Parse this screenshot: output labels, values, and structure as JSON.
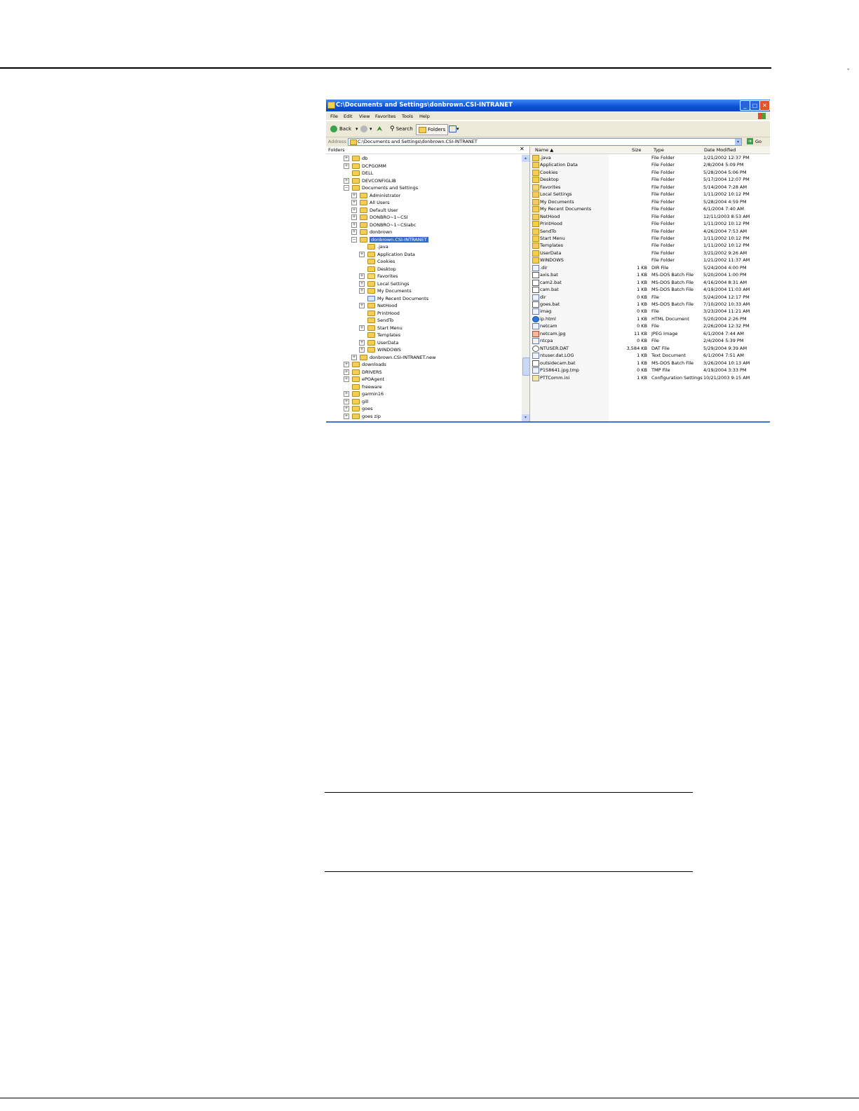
{
  "top_mark": "-",
  "window": {
    "title": "C:\\Documents and Settings\\donbrown.CSI-INTRANET",
    "buttons": {
      "minimize": "_",
      "maximize": "□",
      "close": "✕"
    }
  },
  "menu": [
    "File",
    "Edit",
    "View",
    "Favorites",
    "Tools",
    "Help"
  ],
  "toolbar": {
    "back": "Back",
    "dropdown": "▾",
    "up": "⮝",
    "search": "Search",
    "folders": "Folders",
    "views_drop": "▾"
  },
  "address": {
    "label": "Address",
    "value": "C:\\Documents and Settings\\donbrown.CSI-INTRANET",
    "drop": "▾",
    "go": "Go",
    "go_arrow": "➜"
  },
  "folders_pane": {
    "title": "Folders",
    "close": "✕",
    "items": [
      {
        "label": "db",
        "exp": "+"
      },
      {
        "label": "DCPGOMM",
        "exp": "+"
      },
      {
        "label": "DELL",
        "exp": ""
      },
      {
        "label": "DEVCONFIGLIB",
        "exp": "+"
      },
      {
        "label": "Documents and Settings",
        "exp": "−"
      },
      {
        "label": "Administrator",
        "exp": "+"
      },
      {
        "label": "All Users",
        "exp": "+"
      },
      {
        "label": "Default User",
        "exp": "+"
      },
      {
        "label": "DONBRO~1~CSI",
        "exp": "+"
      },
      {
        "label": "DONBRO~1~CSIabc",
        "exp": "+"
      },
      {
        "label": "donbrown",
        "exp": "+"
      },
      {
        "label": "donbrown.CSI-INTRANET",
        "exp": "−"
      },
      {
        "label": ".java",
        "exp": ""
      },
      {
        "label": "Application Data",
        "exp": "+"
      },
      {
        "label": "Cookies",
        "exp": ""
      },
      {
        "label": "Desktop",
        "exp": ""
      },
      {
        "label": "Favorites",
        "exp": "+"
      },
      {
        "label": "Local Settings",
        "exp": "+"
      },
      {
        "label": "My Documents",
        "exp": "+"
      },
      {
        "label": "My Recent Documents",
        "exp": ""
      },
      {
        "label": "NetHood",
        "exp": "+"
      },
      {
        "label": "PrintHood",
        "exp": ""
      },
      {
        "label": "SendTo",
        "exp": ""
      },
      {
        "label": "Start Menu",
        "exp": "+"
      },
      {
        "label": "Templates",
        "exp": ""
      },
      {
        "label": "UserData",
        "exp": "+"
      },
      {
        "label": "WINDOWS",
        "exp": "+"
      },
      {
        "label": "donbrown.CSI-INTRANET.new",
        "exp": "+"
      },
      {
        "label": "downloads",
        "exp": "+"
      },
      {
        "label": "DRIVERS",
        "exp": "+"
      },
      {
        "label": "ePOAgent",
        "exp": "+"
      },
      {
        "label": "freeware",
        "exp": ""
      },
      {
        "label": "garmin16",
        "exp": "+"
      },
      {
        "label": "gill",
        "exp": "+"
      },
      {
        "label": "goes",
        "exp": "+"
      },
      {
        "label": "goes zip",
        "exp": "+"
      }
    ],
    "scroll_up": "▴",
    "scroll_down": "▾"
  },
  "file_list": {
    "headers": {
      "name": "Name ▲",
      "size": "Size",
      "type": "Type",
      "date": "Date Modified"
    },
    "rows": [
      {
        "name": ".java",
        "size": "",
        "type": "File Folder",
        "date": "1/21/2002 12:37 PM"
      },
      {
        "name": "Application Data",
        "size": "",
        "type": "File Folder",
        "date": "2/8/2004 5:09 PM"
      },
      {
        "name": "Cookies",
        "size": "",
        "type": "File Folder",
        "date": "5/28/2004 5:06 PM"
      },
      {
        "name": "Desktop",
        "size": "",
        "type": "File Folder",
        "date": "5/17/2004 12:07 PM"
      },
      {
        "name": "Favorites",
        "size": "",
        "type": "File Folder",
        "date": "5/14/2004 7:28 AM"
      },
      {
        "name": "Local Settings",
        "size": "",
        "type": "File Folder",
        "date": "1/11/2002 10:12 PM"
      },
      {
        "name": "My Documents",
        "size": "",
        "type": "File Folder",
        "date": "5/28/2004 4:59 PM"
      },
      {
        "name": "My Recent Documents",
        "size": "",
        "type": "File Folder",
        "date": "6/1/2004 7:40 AM"
      },
      {
        "name": "NetHood",
        "size": "",
        "type": "File Folder",
        "date": "12/11/2003 8:53 AM"
      },
      {
        "name": "PrintHood",
        "size": "",
        "type": "File Folder",
        "date": "1/11/2002 10:12 PM"
      },
      {
        "name": "SendTo",
        "size": "",
        "type": "File Folder",
        "date": "4/26/2004 7:53 AM"
      },
      {
        "name": "Start Menu",
        "size": "",
        "type": "File Folder",
        "date": "1/11/2002 10:12 PM"
      },
      {
        "name": "Templates",
        "size": "",
        "type": "File Folder",
        "date": "1/11/2002 10:12 PM"
      },
      {
        "name": "UserData",
        "size": "",
        "type": "File Folder",
        "date": "3/21/2002 9:26 AM"
      },
      {
        "name": "WINDOWS",
        "size": "",
        "type": "File Folder",
        "date": "1/21/2002 11:37 AM"
      },
      {
        "name": ".dir",
        "size": "1 KB",
        "type": "DIR File",
        "date": "5/24/2004 4:00 PM"
      },
      {
        "name": "axis.bat",
        "size": "1 KB",
        "type": "MS-DOS Batch File",
        "date": "5/20/2004 1:00 PM"
      },
      {
        "name": "cam2.bat",
        "size": "1 KB",
        "type": "MS-DOS Batch File",
        "date": "4/16/2004 8:31 AM"
      },
      {
        "name": "cam.bat",
        "size": "1 KB",
        "type": "MS-DOS Batch File",
        "date": "4/19/2004 11:03 AM"
      },
      {
        "name": "dir",
        "size": "0 KB",
        "type": "File",
        "date": "5/24/2004 12:17 PM"
      },
      {
        "name": "goes.bat",
        "size": "1 KB",
        "type": "MS-DOS Batch File",
        "date": "7/10/2002 10:33 AM"
      },
      {
        "name": "imag",
        "size": "0 KB",
        "type": "File",
        "date": "3/23/2004 11:21 AM"
      },
      {
        "name": "ip.html",
        "size": "1 KB",
        "type": "HTML Document",
        "date": "5/20/2004 2:26 PM"
      },
      {
        "name": "netcam",
        "size": "0 KB",
        "type": "File",
        "date": "2/26/2004 12:32 PM"
      },
      {
        "name": "netcam.jpg",
        "size": "11 KB",
        "type": "JPEG Image",
        "date": "6/1/2004 7:44 AM"
      },
      {
        "name": "ntcpa",
        "size": "0 KB",
        "type": "File",
        "date": "2/4/2004 5:39 PM"
      },
      {
        "name": "NTUSER.DAT",
        "size": "3,584 KB",
        "type": "DAT File",
        "date": "5/29/2004 9:39 AM"
      },
      {
        "name": "ntuser.dat.LOG",
        "size": "1 KB",
        "type": "Text Document",
        "date": "6/1/2004 7:51 AM"
      },
      {
        "name": "outsidecam.bat",
        "size": "1 KB",
        "type": "MS-DOS Batch File",
        "date": "3/26/2004 10:13 AM"
      },
      {
        "name": "P1S8641.jpg.tmp",
        "size": "0 KB",
        "type": "TMP File",
        "date": "4/19/2004 3:33 PM"
      },
      {
        "name": "PTTComm.ini",
        "size": "1 KB",
        "type": "Configuration Settings",
        "date": "10/21/2003 9:15 AM"
      }
    ]
  }
}
